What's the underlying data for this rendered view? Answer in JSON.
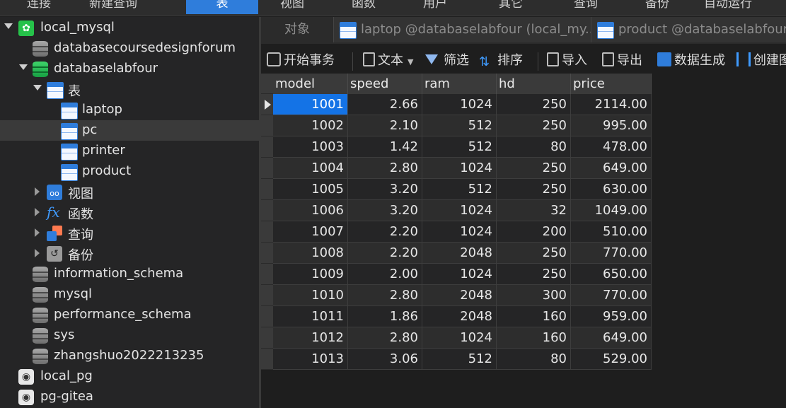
{
  "menubar": {
    "items": [
      "连接",
      "新建查询",
      "表",
      "视图",
      "函数",
      "用户",
      "其它",
      "查询",
      "备份",
      "自动运行"
    ],
    "active_index": 2
  },
  "sidebar": {
    "connection": "local_mysql",
    "databases": [
      "databasecoursedesignforum",
      "databaselabfour"
    ],
    "tables_group": "表",
    "tables": [
      "laptop",
      "pc",
      "printer",
      "product"
    ],
    "selected_table": "pc",
    "groups": [
      "视图",
      "函数",
      "查询",
      "备份"
    ],
    "other_databases": [
      "information_schema",
      "mysql",
      "performance_schema",
      "sys",
      "zhangshuo2022213235"
    ],
    "other_connections": [
      "local_pg",
      "pg-gitea"
    ]
  },
  "tabs": {
    "objects": "对象",
    "documents": [
      "laptop @databaselabfour (local_my...",
      "product @databaselabfour"
    ]
  },
  "toolbar": {
    "begin_transaction": "开始事务",
    "text": "文本",
    "filter": "筛选",
    "sort": "排序",
    "import": "导入",
    "export": "导出",
    "data_generation": "数据生成",
    "create": "创建图"
  },
  "grid": {
    "columns": [
      "model",
      "speed",
      "ram",
      "hd",
      "price"
    ],
    "rows": [
      [
        "1001",
        "2.66",
        "1024",
        "250",
        "2114.00"
      ],
      [
        "1002",
        "2.10",
        "512",
        "250",
        "995.00"
      ],
      [
        "1003",
        "1.42",
        "512",
        "80",
        "478.00"
      ],
      [
        "1004",
        "2.80",
        "1024",
        "250",
        "649.00"
      ],
      [
        "1005",
        "3.20",
        "512",
        "250",
        "630.00"
      ],
      [
        "1006",
        "3.20",
        "1024",
        "32",
        "1049.00"
      ],
      [
        "1007",
        "2.20",
        "1024",
        "200",
        "510.00"
      ],
      [
        "1008",
        "2.20",
        "2048",
        "250",
        "770.00"
      ],
      [
        "1009",
        "2.00",
        "1024",
        "250",
        "650.00"
      ],
      [
        "1010",
        "2.80",
        "2048",
        "300",
        "770.00"
      ],
      [
        "1011",
        "1.86",
        "2048",
        "160",
        "959.00"
      ],
      [
        "1012",
        "2.80",
        "1024",
        "160",
        "649.00"
      ],
      [
        "1013",
        "3.06",
        "512",
        "80",
        "529.00"
      ]
    ]
  }
}
